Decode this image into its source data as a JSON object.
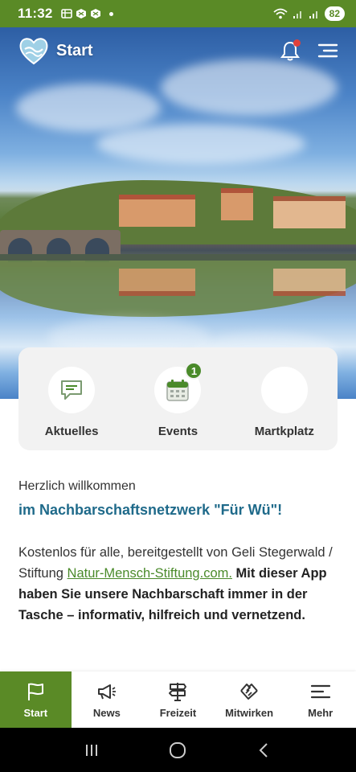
{
  "status_bar": {
    "time": "11:32",
    "battery": "82"
  },
  "header": {
    "title": "Start"
  },
  "quick_links": [
    {
      "label": "Aktuelles",
      "icon": "chat-icon"
    },
    {
      "label": "Events",
      "icon": "calendar-icon",
      "badge": "1"
    },
    {
      "label": "Martkplatz",
      "icon": ""
    }
  ],
  "welcome": {
    "line1": "Herzlich willkommen",
    "line2": "im Nachbarschaftsnetzwerk \"Für Wü\"!",
    "intro_prefix": "Kostenlos für alle, bereitgestellt von Geli Stegerwald / Stiftung ",
    "intro_link": "Natur-Mensch-Stiftung.com.",
    "intro_bold": "Mit dieser App haben Sie unsere Nachbarschaft immer in der Tasche – informativ, hilfreich und vernetzend."
  },
  "bottom_nav": [
    {
      "label": "Start",
      "icon": "flag-icon",
      "active": true
    },
    {
      "label": "News",
      "icon": "megaphone-icon",
      "active": false
    },
    {
      "label": "Freizeit",
      "icon": "signpost-icon",
      "active": false
    },
    {
      "label": "Mitwirken",
      "icon": "handshake-icon",
      "active": false
    },
    {
      "label": "Mehr",
      "icon": "menu-icon",
      "active": false
    }
  ],
  "colors": {
    "brand_green": "#5a8a26",
    "title_blue": "#1f6a8a",
    "link_green": "#4a8a2a",
    "notification_red": "#e0413c"
  }
}
